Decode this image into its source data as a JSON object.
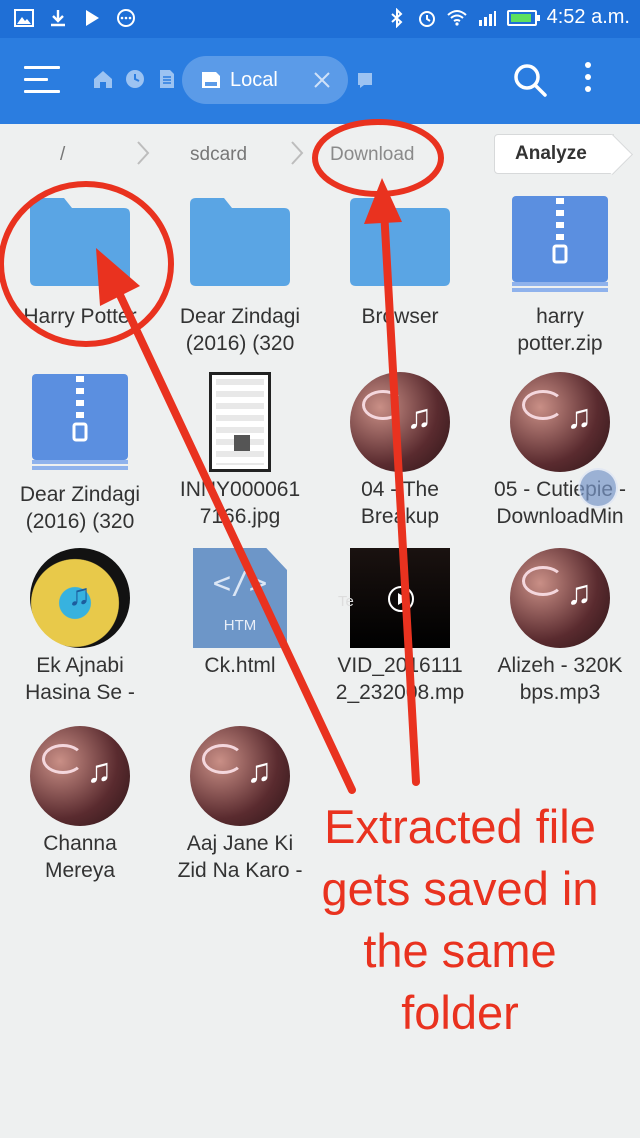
{
  "status_bar": {
    "time": "4:52 a.m.",
    "left_icons": [
      "gallery-icon",
      "download-icon",
      "play-store-icon",
      "more-notifications-icon"
    ],
    "right_icons": [
      "bluetooth-icon",
      "alarm-icon",
      "wifi-icon",
      "signal-icon",
      "battery-icon"
    ],
    "battery_color": "#5ee05e"
  },
  "app_bar": {
    "color": "#2b7de0",
    "tab_label": "Local",
    "nav_icons": [
      "home-icon",
      "recent-icon",
      "document-icon"
    ]
  },
  "breadcrumb": {
    "items": [
      "/",
      "sdcard",
      "Download"
    ],
    "analyze_label": "Analyze"
  },
  "files": [
    {
      "line1": "Harry Potter",
      "line2": "",
      "kind": "folder"
    },
    {
      "line1": "Dear Zindagi",
      "line2": "(2016) (320",
      "kind": "folder"
    },
    {
      "line1": "Browser",
      "line2": "",
      "kind": "folder"
    },
    {
      "line1": "harry",
      "line2": "potter.zip",
      "kind": "zip"
    },
    {
      "line1": "Dear Zindagi",
      "line2": "(2016) (320",
      "kind": "zip"
    },
    {
      "line1": "INNY000061",
      "line2": "7166.jpg",
      "kind": "image"
    },
    {
      "line1": "04 - The",
      "line2": "Breakup",
      "kind": "audio"
    },
    {
      "line1": "05 - Cutiepie -",
      "line2": "DownloadMin",
      "kind": "audio"
    },
    {
      "line1": "Ek Ajnabi",
      "line2": "Hasina Se -",
      "kind": "audio"
    },
    {
      "line1": "Ck.html",
      "line2": "",
      "kind": "html"
    },
    {
      "line1": "VID_2016111",
      "line2": "2_232008.mp",
      "kind": "video"
    },
    {
      "line1": "Alizeh - 320K",
      "line2": "bps.mp3",
      "kind": "audio"
    },
    {
      "line1": "Channa",
      "line2": "Mereya",
      "kind": "audio"
    },
    {
      "line1": "Aaj Jane Ki",
      "line2": "Zid Na Karo -",
      "kind": "audio"
    }
  ],
  "thumb_text": {
    "html_ext": "HTM",
    "video_caption": "Te"
  },
  "annotation": {
    "color": "#e9321f",
    "lines": [
      "Extracted file",
      "gets saved in",
      "the same",
      "folder"
    ]
  }
}
